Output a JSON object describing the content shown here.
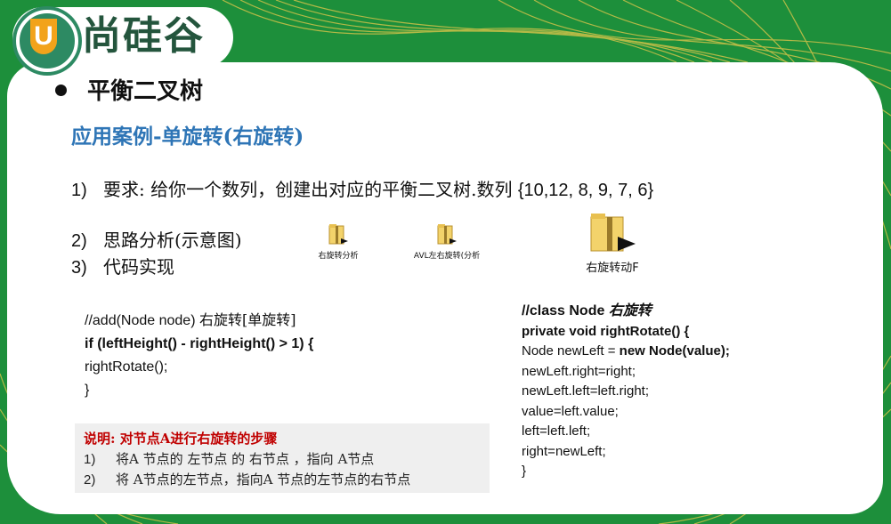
{
  "brand": {
    "logo_letter": "U",
    "logo_text": "尚硅谷"
  },
  "slide": {
    "title": "平衡二叉树",
    "subtitle": "应用案例-单旋转(右旋转)"
  },
  "items": [
    {
      "num": "1)",
      "text": "要求: 给你一个数列，创建出对应的平衡二叉树.数列 ",
      "seq": "{10,12, 8, 9, 7, 6}"
    },
    {
      "num": "2)",
      "text": "思路分析(示意图)"
    },
    {
      "num": "3)",
      "text": "代码实现"
    }
  ],
  "files": [
    {
      "label": "右旋转分析",
      "icon": "folder-zip-icon"
    },
    {
      "label": "AVL左右旋转(分析",
      "icon": "folder-zip-icon"
    },
    {
      "label": "右旋转动F",
      "icon": "folder-zip-icon"
    }
  ],
  "code_left": {
    "l1_a": "//add(Node node) ",
    "l1_b": "右旋转[单旋转]",
    "l2": "if (leftHeight() - rightHeight() > 1) {",
    "l3": "rightRotate();",
    "l4": "}"
  },
  "code_right": {
    "l1_a": "//class Node ",
    "l1_b": "右旋转",
    "l2": "private void rightRotate() {",
    "l3_a": "Node newLeft = ",
    "l3_b": "new Node(value);",
    "l4": "newLeft.right=right;",
    "l5": "newLeft.left=left.right;",
    "l6": "value=left.value;",
    "l7": "left=left.left;",
    "l8": "right=newLeft;",
    "l9": "}"
  },
  "note": {
    "title": "说明: 对节点A进行右旋转的步骤",
    "items": [
      {
        "num": "1)",
        "text": "将A 节点的 左节点 的 右节点 ，指向 A节点"
      },
      {
        "num": "2)",
        "text": "将 A节点的左节点，指向A 节点的左节点的右节点"
      }
    ]
  },
  "colors": {
    "background_green": "#1d8f3b",
    "line_gold": "#e6c84a",
    "subtitle_blue": "#2e75b6",
    "note_red": "#c00000",
    "logo_green": "#2d8a63",
    "logo_orange": "#f2a31b"
  }
}
